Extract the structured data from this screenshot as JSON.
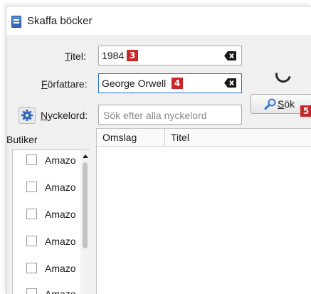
{
  "window": {
    "title": "Skaffa böcker"
  },
  "form": {
    "title_label_u": "T",
    "title_label_rest": "itel:",
    "title_value": "1984",
    "author_label_u": "F",
    "author_label_rest": "örfattare:",
    "author_value": "George Orwell",
    "keyword_label_u": "N",
    "keyword_label_rest": "yckelord:",
    "keyword_placeholder": "Sök efter alla nyckelord"
  },
  "search_button": {
    "label_u": "S",
    "label_rest": "ök"
  },
  "badges": {
    "title": "3",
    "author": "4",
    "search": "5"
  },
  "stores": {
    "header": "Butiker",
    "items": [
      "Amazo",
      "Amazo",
      "Amazo",
      "Amazo",
      "Amazo",
      "Amazo"
    ]
  },
  "results": {
    "columns": [
      "Omslag",
      "Titel"
    ]
  },
  "colors": {
    "accent": "#2b6fc9",
    "badge": "#c9262a"
  }
}
